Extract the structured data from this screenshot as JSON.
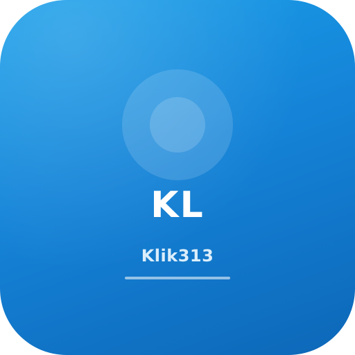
{
  "icon": {
    "initials": "KL",
    "name": "Klik313",
    "colors": {
      "gradient_start": "#1aa0ea",
      "gradient_end": "#0d67b8",
      "text": "#ffffff"
    },
    "decoration": "circle-icon"
  }
}
